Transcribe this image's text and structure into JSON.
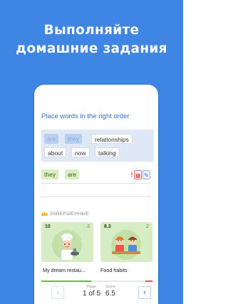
{
  "headline": {
    "line1": "Выполняйте",
    "line2": "домашние задания"
  },
  "task": {
    "instruction": "Place words in the right order",
    "placed_ghosts": [
      "are",
      "they"
    ],
    "available_words": [
      "relationships",
      "about",
      "now",
      "talking"
    ],
    "answer_words": [
      "they",
      "are"
    ]
  },
  "tools": {
    "mark_icon": "exclamation-icon",
    "doc_icon": "document-icon",
    "edit_icon": "wrench-icon"
  },
  "completed": {
    "label": "ЗАВЕРШЕННЫЕ",
    "cards": [
      {
        "score": "10",
        "number": "3",
        "title": "My dream restau..."
      },
      {
        "score": "8.3",
        "number": "2",
        "title": "Food habits"
      }
    ]
  },
  "pager": {
    "page_label": "Page",
    "page_value": "1 of 5",
    "score_label": "Score",
    "score_value": "6.5",
    "prev_icon": "chevron-left-icon",
    "next_icon": "chevron-right-icon"
  },
  "progress": {
    "fraction": 0.45
  },
  "colors": {
    "background": "#3f86e4",
    "accent": "#3e72bf",
    "card_green": "#d6ecc4"
  }
}
